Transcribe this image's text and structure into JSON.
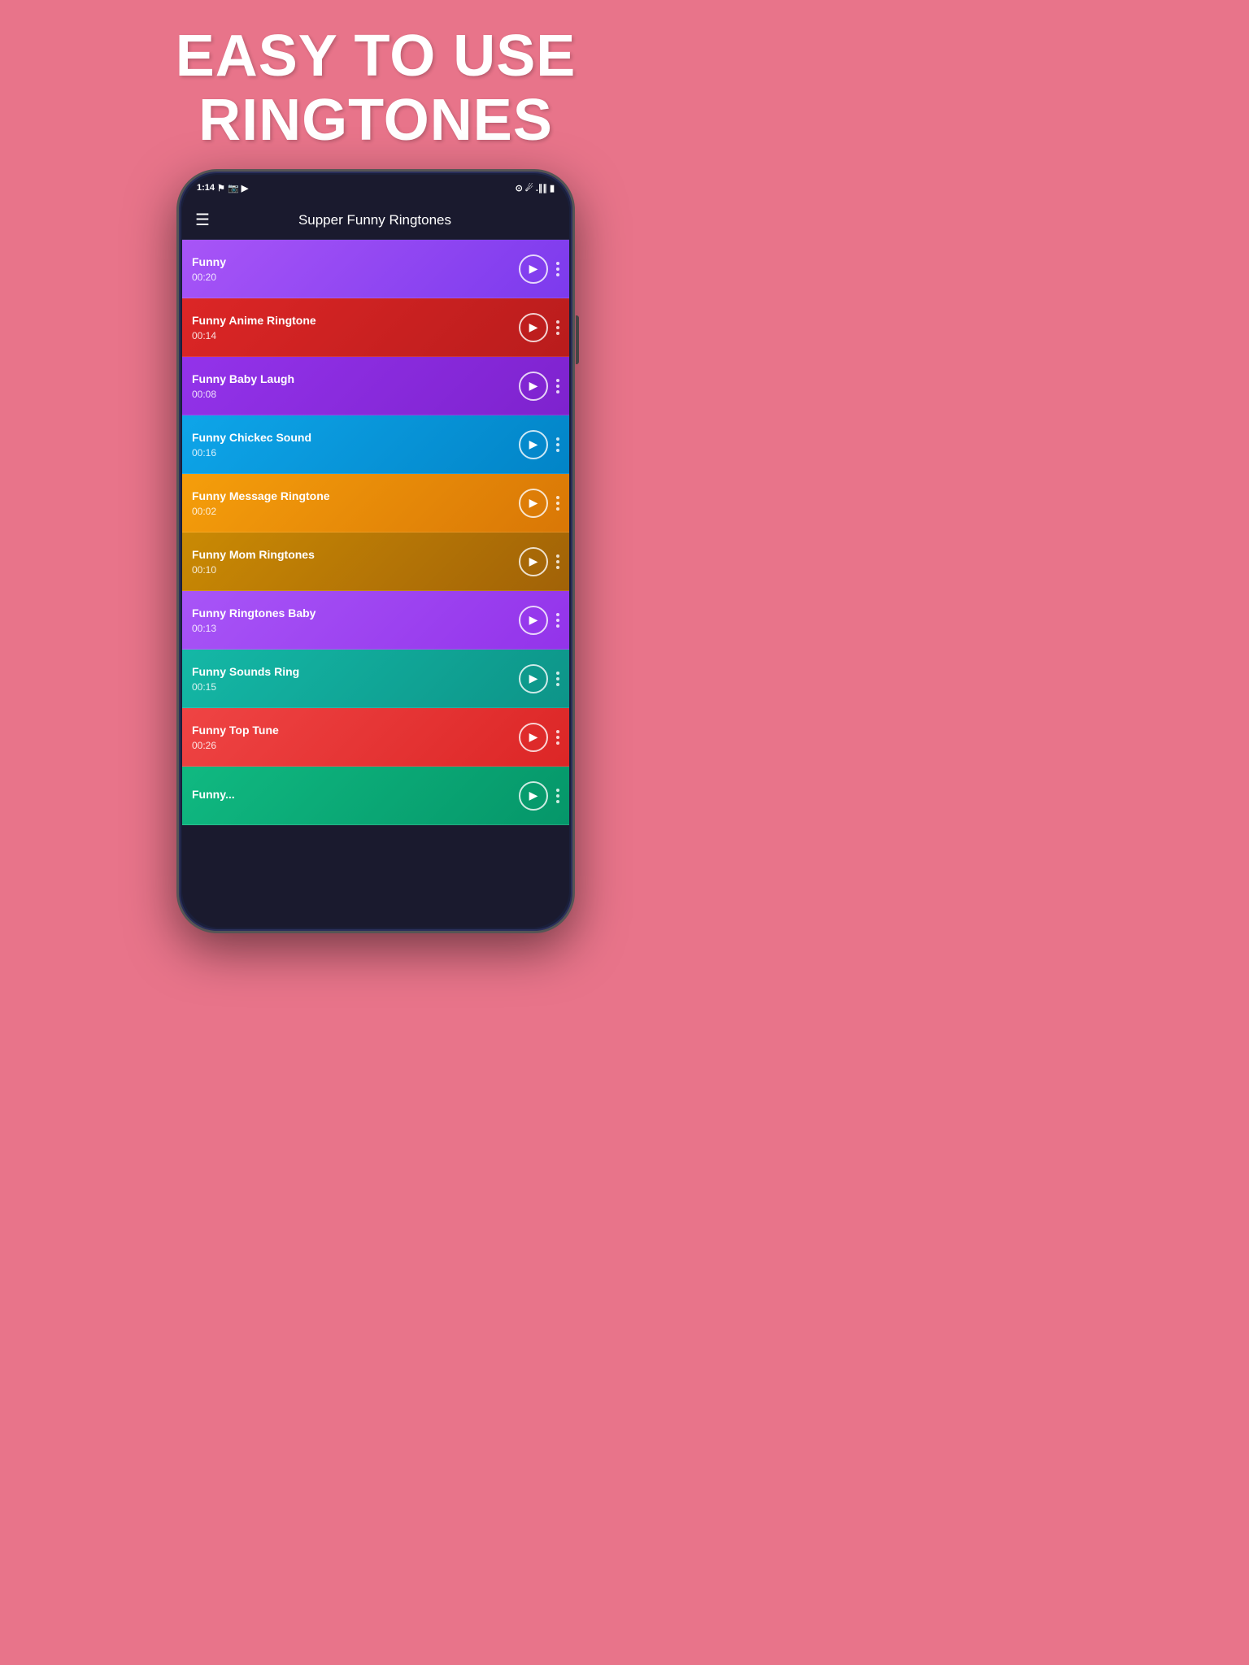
{
  "headline": {
    "line1": "EASY TO USE",
    "line2": "RINGTONES"
  },
  "phone": {
    "status_bar": {
      "time": "1:14",
      "right_icons": "🔋"
    },
    "app_bar": {
      "title": "Supper Funny Ringtones"
    },
    "ringtones": [
      {
        "id": 1,
        "name": "Funny",
        "duration": "00:20",
        "color_class": "item-1"
      },
      {
        "id": 2,
        "name": "Funny Anime Ringtone",
        "duration": "00:14",
        "color_class": "item-2"
      },
      {
        "id": 3,
        "name": "Funny Baby Laugh",
        "duration": "00:08",
        "color_class": "item-3"
      },
      {
        "id": 4,
        "name": "Funny Chickec Sound",
        "duration": "00:16",
        "color_class": "item-4"
      },
      {
        "id": 5,
        "name": "Funny Message Ringtone",
        "duration": "00:02",
        "color_class": "item-5"
      },
      {
        "id": 6,
        "name": "Funny Mom Ringtones",
        "duration": "00:10",
        "color_class": "item-6"
      },
      {
        "id": 7,
        "name": "Funny Ringtones Baby",
        "duration": "00:13",
        "color_class": "item-7"
      },
      {
        "id": 8,
        "name": "Funny Sounds Ring",
        "duration": "00:15",
        "color_class": "item-8"
      },
      {
        "id": 9,
        "name": "Funny Top Tune",
        "duration": "00:26",
        "color_class": "item-9"
      },
      {
        "id": 10,
        "name": "Funny...",
        "duration": "",
        "color_class": "item-10"
      }
    ]
  }
}
